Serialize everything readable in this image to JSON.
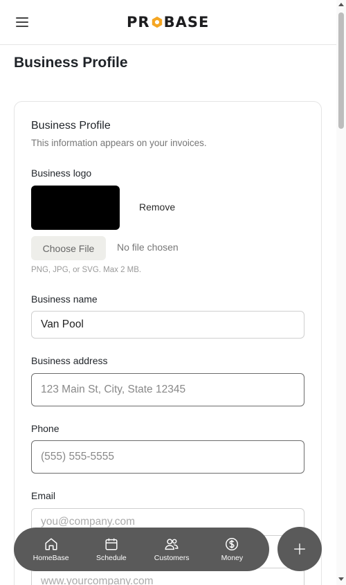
{
  "header": {
    "logo_text_left": "PR",
    "logo_text_right": "BASE"
  },
  "page": {
    "title": "Business Profile"
  },
  "card": {
    "title": "Business Profile",
    "subtitle": "This information appears on your invoices."
  },
  "logo_section": {
    "label": "Business logo",
    "remove_label": "Remove",
    "choose_file_label": "Choose File",
    "no_file_text": "No file chosen",
    "hint": "PNG, JPG, or SVG. Max 2 MB."
  },
  "fields": {
    "name": {
      "label": "Business name",
      "value": "Van Pool",
      "placeholder": ""
    },
    "address": {
      "label": "Business address",
      "value": "",
      "placeholder": "123 Main St, City, State 12345"
    },
    "phone": {
      "label": "Phone",
      "value": "",
      "placeholder": "(555) 555-5555"
    },
    "email": {
      "label": "Email",
      "value": "",
      "placeholder": "you@company.com"
    },
    "website": {
      "value": "",
      "placeholder": "www.yourcompany.com"
    }
  },
  "nav": {
    "items": [
      {
        "label": "HomeBase",
        "icon": "home-icon"
      },
      {
        "label": "Schedule",
        "icon": "calendar-icon"
      },
      {
        "label": "Customers",
        "icon": "users-icon"
      },
      {
        "label": "Money",
        "icon": "dollar-icon"
      }
    ]
  },
  "colors": {
    "nav_bg": "#5a5a5a",
    "logo_accent": "#f5a623"
  }
}
